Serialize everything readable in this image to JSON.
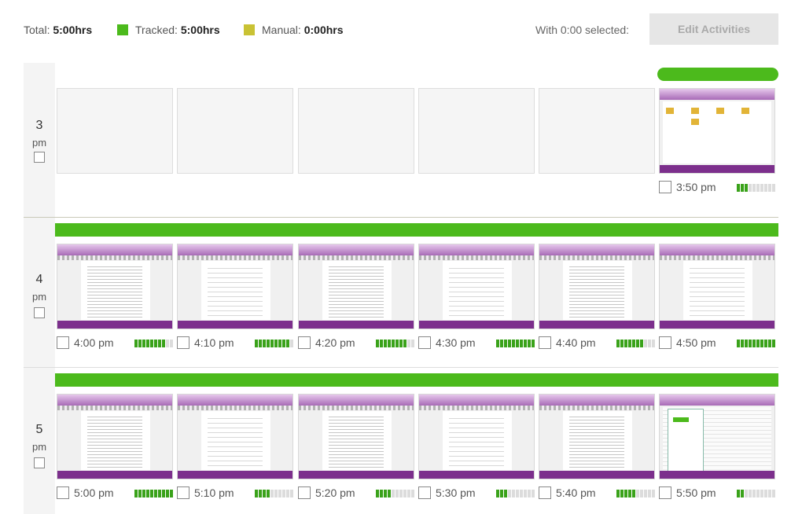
{
  "summary": {
    "total_label": "Total:",
    "total_value": "5:00hrs",
    "tracked_label": "Tracked:",
    "tracked_value": "5:00hrs",
    "manual_label": "Manual:",
    "manual_value": "0:00hrs",
    "tracked_color": "#4cba1c",
    "manual_color": "#c9c234",
    "selected_text": "With 0:00 selected:",
    "edit_button": "Edit Activities"
  },
  "hours": [
    {
      "hour": "3",
      "ampm": "pm",
      "activity_fraction": 0.167,
      "slots": [
        {
          "time": "",
          "screenshot": false,
          "activity_level": 0
        },
        {
          "time": "",
          "screenshot": false,
          "activity_level": 0
        },
        {
          "time": "",
          "screenshot": false,
          "activity_level": 0
        },
        {
          "time": "",
          "screenshot": false,
          "activity_level": 0
        },
        {
          "time": "",
          "screenshot": false,
          "activity_level": 0
        },
        {
          "time": "3:50 pm",
          "screenshot": true,
          "kind": "desktop",
          "activity_level": 3
        }
      ]
    },
    {
      "hour": "4",
      "ampm": "pm",
      "activity_fraction": 1,
      "slots": [
        {
          "time": "4:00 pm",
          "screenshot": true,
          "kind": "document",
          "activity_level": 8
        },
        {
          "time": "4:10 pm",
          "screenshot": true,
          "kind": "document",
          "activity_level": 9
        },
        {
          "time": "4:20 pm",
          "screenshot": true,
          "kind": "document",
          "activity_level": 8
        },
        {
          "time": "4:30 pm",
          "screenshot": true,
          "kind": "document",
          "activity_level": 10
        },
        {
          "time": "4:40 pm",
          "screenshot": true,
          "kind": "document",
          "activity_level": 7
        },
        {
          "time": "4:50 pm",
          "screenshot": true,
          "kind": "document",
          "activity_level": 10
        }
      ]
    },
    {
      "hour": "5",
      "ampm": "pm",
      "activity_fraction": 1,
      "slots": [
        {
          "time": "5:00 pm",
          "screenshot": true,
          "kind": "document",
          "activity_level": 10
        },
        {
          "time": "5:10 pm",
          "screenshot": true,
          "kind": "document",
          "activity_level": 4
        },
        {
          "time": "5:20 pm",
          "screenshot": true,
          "kind": "document",
          "activity_level": 4
        },
        {
          "time": "5:30 pm",
          "screenshot": true,
          "kind": "document",
          "activity_level": 3
        },
        {
          "time": "5:40 pm",
          "screenshot": true,
          "kind": "document",
          "activity_level": 5
        },
        {
          "time": "5:50 pm",
          "screenshot": true,
          "kind": "app-window",
          "activity_level": 2
        }
      ]
    }
  ]
}
